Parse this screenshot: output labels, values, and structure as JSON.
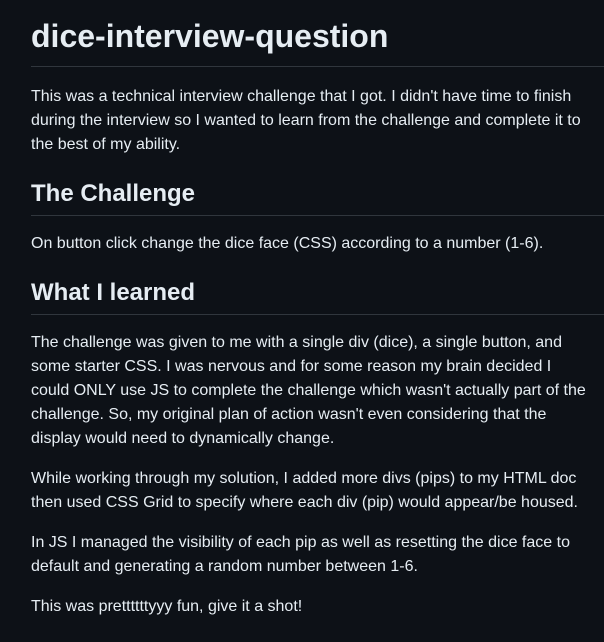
{
  "readme": {
    "title": "dice-interview-question",
    "intro": "This was a technical interview challenge that I got. I didn't have time to finish during the interview so I wanted to learn from the challenge and complete it to the best of my ability.",
    "sections": [
      {
        "heading": "The Challenge",
        "paragraphs": [
          "On button click change the dice face (CSS) according to a number (1-6)."
        ]
      },
      {
        "heading": "What I learned",
        "paragraphs": [
          "The challenge was given to me with a single div (dice), a single button, and some starter CSS. I was nervous and for some reason my brain decided I could ONLY use JS to complete the challenge which wasn't actually part of the challenge. So, my original plan of action wasn't even considering that the display would need to dynamically change.",
          "While working through my solution, I added more divs (pips) to my HTML doc then used CSS Grid to specify where each div (pip) would appear/be housed.",
          "In JS I managed the visibility of each pip as well as resetting the dice face to default and generating a random number between 1-6.",
          "This was prettttttyyy fun, give it a shot!"
        ]
      }
    ]
  }
}
